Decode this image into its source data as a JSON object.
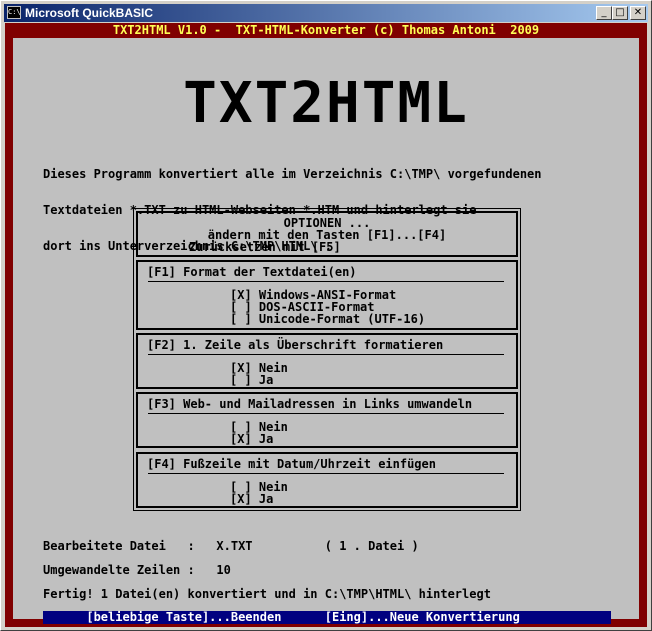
{
  "window": {
    "title": "Microsoft QuickBASIC",
    "icon_text": "C:\\",
    "buttons": {
      "minimize": "_",
      "maximize": "□",
      "close": "✕"
    }
  },
  "topline": "TXT2HTML V1.0 -  TXT-HTML-Konverter (c) Thomas Antoni  2009",
  "logo": "TXT2HTML",
  "intro": [
    "Dieses Programm konvertiert alle im Verzeichnis C:\\TMP\\ vorgefundenen",
    "Textdateien *.TXT zu HTML-Webseiten *.HTM und hinterlegt sie",
    "dort ins Unterverzeichnis C:\\TMP\\HTML\\ ."
  ],
  "options": {
    "header": [
      "OPTIONEN ...",
      "ändern mit den Tasten [F1]...[F4]",
      "Zurücksetzen mit [F5]"
    ],
    "f1": {
      "title": "[F1] Format der Textdatei(en)",
      "items": [
        "[X] Windows-ANSI-Format",
        "[ ] DOS-ASCII-Format",
        "[ ] Unicode-Format (UTF-16)"
      ]
    },
    "f2": {
      "title": "[F2] 1. Zeile als Überschrift formatieren",
      "items": [
        "[X] Nein",
        "[ ] Ja"
      ]
    },
    "f3": {
      "title": "[F3] Web- und Mailadressen in Links umwandeln",
      "items": [
        "[ ] Nein",
        "[X] Ja"
      ]
    },
    "f4": {
      "title": "[F4] Fußzeile mit Datum/Uhrzeit einfügen",
      "items": [
        "[ ] Nein",
        "[X] Ja"
      ]
    }
  },
  "status": {
    "line1": "Bearbeitete Datei   :   X.TXT          ( 1 . Datei )",
    "line2": "Umgewandelte Zeilen :   10",
    "line3": "Fertig! 1 Datei(en) konvertiert und in C:\\TMP\\HTML\\ hinterlegt"
  },
  "bottombar": "      [beliebige Taste]...Beenden      [Eing]...Neue Konvertierung",
  "colors": {
    "frame": "#800000",
    "panel": "#c0c0c0",
    "topline_text": "#ffff55",
    "statusbar": "#000080",
    "titlebar": "#0a246a"
  }
}
